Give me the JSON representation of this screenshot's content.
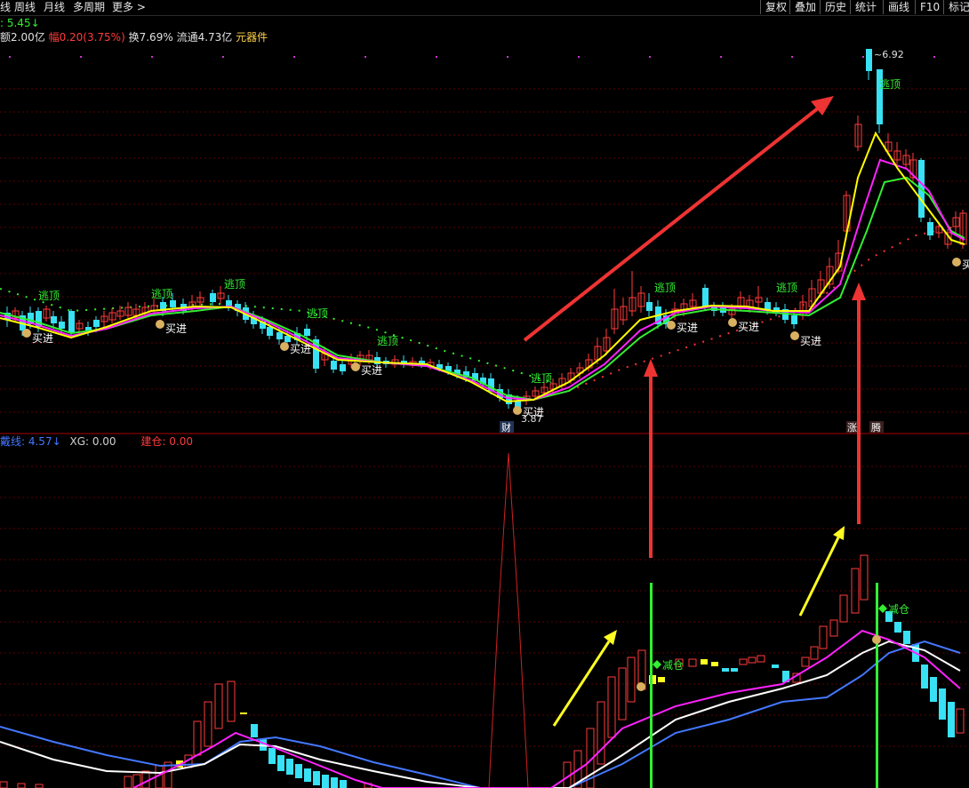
{
  "toolbar": {
    "left_tabs": [
      "线",
      "周线",
      "月线",
      "多周期",
      "更多 >"
    ],
    "right_buttons": [
      "复权",
      "叠加",
      "历史",
      "统计",
      "画线",
      "F10",
      "标记"
    ]
  },
  "info": {
    "ma_value": ": 5.45",
    "ma_arrow": "↓",
    "amount_label": "额2.00亿",
    "change_label": "幅0.20(3.75%)",
    "turnover_label": "换7.69%",
    "float_label": "流通4.73亿",
    "sector_label": "元器件"
  },
  "main_chart": {
    "high_label": "6.92",
    "low_label": "3.87",
    "signal_top": "逃顶",
    "signal_buy": "买进",
    "marker_cai": "财",
    "marker_zhang": "涨",
    "marker_teng": "腾"
  },
  "sub_chart": {
    "legend_name": "戴线: 4.57",
    "legend_arrow": "↓",
    "legend_xg": "XG: 0.00",
    "legend_build": "建仓: 0.00",
    "reduce_label": "减仓"
  },
  "colors": {
    "background": "#000000",
    "up_red": "#ff3b3b",
    "down_cyan": "#38e1f4",
    "ma_yellow": "#ffff00",
    "ma_magenta": "#ff22ff",
    "ma_green": "#33ee33",
    "signal_green": "#33ee33",
    "arrow_red": "#ee3333",
    "arrow_yellow": "#ffff22",
    "sub_white": "#ffffff",
    "sub_blue": "#4477ff",
    "sub_magenta": "#ff22ff"
  }
}
